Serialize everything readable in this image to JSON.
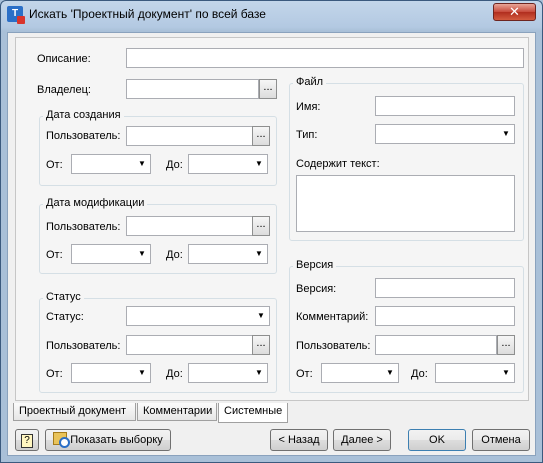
{
  "window": {
    "title": "Искать 'Проектный документ' по всей базе",
    "icon": "app-logo-icon",
    "close_glyph": "✕"
  },
  "form": {
    "description_label": "Описание:",
    "description_value": "",
    "owner_label": "Владелец:",
    "owner_value": "",
    "ellipsis": "...",
    "combo_arrow": "▼",
    "created": {
      "title": "Дата создания",
      "user_label": "Пользователь:",
      "from_label": "От:",
      "to_label": "До:"
    },
    "modified": {
      "title": "Дата модификации",
      "user_label": "Пользователь:",
      "from_label": "От:",
      "to_label": "До:"
    },
    "status": {
      "title": "Статус",
      "status_label": "Статус:",
      "user_label": "Пользователь:",
      "from_label": "От:",
      "to_label": "До:"
    },
    "file": {
      "title": "Файл",
      "name_label": "Имя:",
      "type_label": "Тип:",
      "contains_label": "Содержит текст:"
    },
    "version": {
      "title": "Версия",
      "version_label": "Версия:",
      "comment_label": "Комментарий:",
      "user_label": "Пользователь:",
      "from_label": "От:",
      "to_label": "До:"
    }
  },
  "tabs": [
    {
      "label": "Проектный документ",
      "active": false
    },
    {
      "label": "Комментарии",
      "active": false
    },
    {
      "label": "Системные",
      "active": true
    }
  ],
  "buttons": {
    "help_glyph": "?",
    "show_selection": "Показать выборку",
    "back": "< Назад",
    "next": "Далее >",
    "ok": "OK",
    "cancel": "Отмена"
  }
}
